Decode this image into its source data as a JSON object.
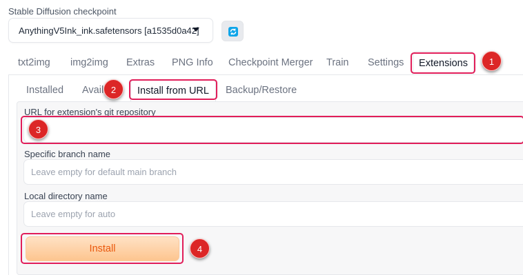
{
  "checkpoint": {
    "label": "Stable Diffusion checkpoint",
    "value": "AnythingV5Ink_ink.safetensors [a1535d0a42]"
  },
  "top_tabs": [
    "txt2img",
    "img2img",
    "Extras",
    "PNG Info",
    "Checkpoint Merger",
    "Train",
    "Settings",
    "Extensions"
  ],
  "active_top_tab": "Extensions",
  "sub_tabs": [
    "Installed",
    "Available",
    "Install from URL",
    "Backup/Restore"
  ],
  "active_sub_tab": "Install from URL",
  "form": {
    "url_label": "URL for extension's git repository",
    "url_value": "",
    "branch_label": "Specific branch name",
    "branch_placeholder": "Leave empty for default main branch",
    "dir_label": "Local directory name",
    "dir_placeholder": "Leave empty for auto",
    "install_label": "Install"
  },
  "annotations": [
    "1",
    "2",
    "3",
    "4"
  ],
  "colors": {
    "annotation": "#dc2626",
    "highlight": "#e11d59",
    "install_text": "#ea580c",
    "refresh_icon": "#0ea5e9"
  },
  "icons": {
    "refresh": "refresh-icon",
    "dropdown": "chevron-down-icon"
  }
}
